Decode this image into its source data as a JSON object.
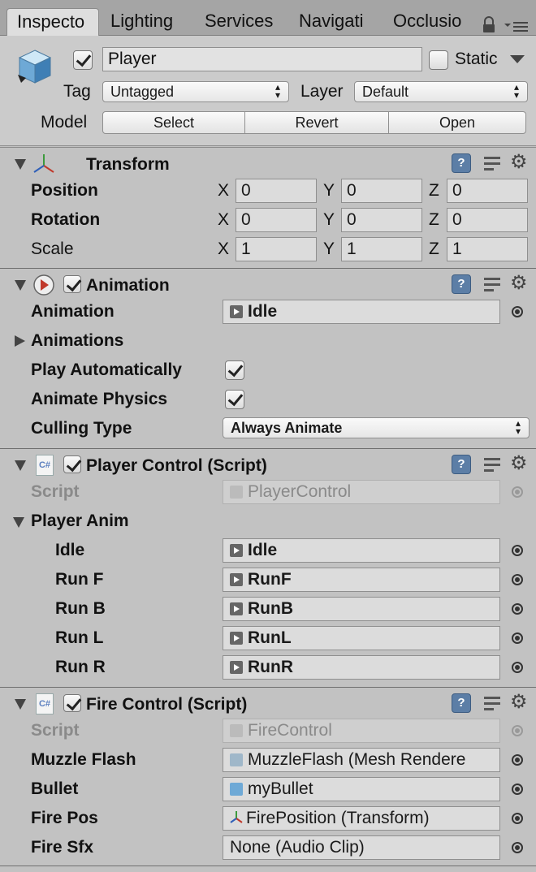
{
  "tabs": [
    "Inspecto",
    "Lighting",
    "Services",
    "Navigati",
    "Occlusio"
  ],
  "header": {
    "name": "Player",
    "static_label": "Static",
    "tag_label": "Tag",
    "tag_value": "Untagged",
    "layer_label": "Layer",
    "layer_value": "Default",
    "model_label": "Model",
    "model_buttons": [
      "Select",
      "Revert",
      "Open"
    ]
  },
  "transform": {
    "title": "Transform",
    "rows": [
      {
        "label": "Position",
        "x": "0",
        "y": "0",
        "z": "0"
      },
      {
        "label": "Rotation",
        "x": "0",
        "y": "0",
        "z": "0"
      },
      {
        "label": "Scale",
        "x": "1",
        "y": "1",
        "z": "1"
      }
    ],
    "axis": [
      "X",
      "Y",
      "Z"
    ]
  },
  "animation": {
    "title": "Animation",
    "animation_label": "Animation",
    "animation_value": "Idle",
    "animations_label": "Animations",
    "play_auto_label": "Play Automatically",
    "play_auto": true,
    "animate_physics_label": "Animate Physics",
    "animate_physics": true,
    "culling_label": "Culling Type",
    "culling_value": "Always Animate"
  },
  "player_control": {
    "title": "Player Control (Script)",
    "script_label": "Script",
    "script_value": "PlayerControl",
    "group_label": "Player Anim",
    "items": [
      {
        "label": "Idle",
        "value": "Idle"
      },
      {
        "label": "Run F",
        "value": "RunF"
      },
      {
        "label": "Run B",
        "value": "RunB"
      },
      {
        "label": "Run L",
        "value": "RunL"
      },
      {
        "label": "Run R",
        "value": "RunR"
      }
    ]
  },
  "fire_control": {
    "title": "Fire Control (Script)",
    "script_label": "Script",
    "script_value": "FireControl",
    "items": [
      {
        "label": "Muzzle Flash",
        "value": "MuzzleFlash (Mesh Rendere"
      },
      {
        "label": "Bullet",
        "value": "myBullet"
      },
      {
        "label": "Fire Pos",
        "value": "FirePosition (Transform)"
      },
      {
        "label": "Fire Sfx",
        "value": "None (Audio Clip)"
      }
    ]
  },
  "icons": {
    "cs_label": "C#",
    "help_label": "?"
  }
}
